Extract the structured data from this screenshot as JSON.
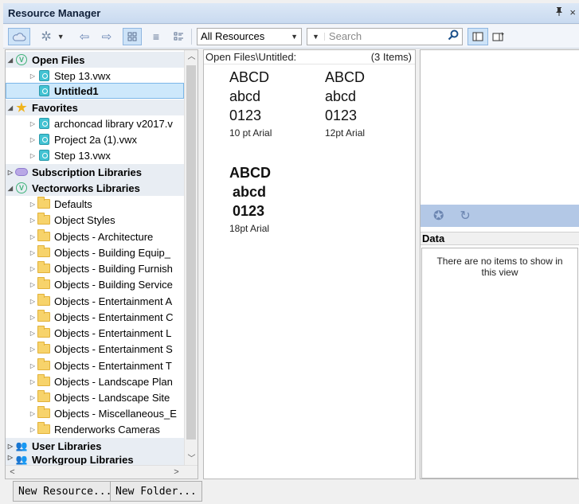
{
  "window": {
    "title": "Resource Manager",
    "pin_icon": "pin-icon",
    "close_glyph": "×"
  },
  "toolbar": {
    "filter_value": "All Resources",
    "search_placeholder": "Search"
  },
  "tree": {
    "open_files": {
      "label": "Open Files",
      "items": [
        "Step 13.vwx",
        "Untitled1"
      ]
    },
    "favorites": {
      "label": "Favorites",
      "items": [
        "archoncad library v2017.v",
        "Project 2a (1).vwx",
        "Step 13.vwx"
      ]
    },
    "subscription": {
      "label": "Subscription Libraries"
    },
    "vectorworks": {
      "label": "Vectorworks Libraries",
      "items": [
        "Defaults",
        "Object Styles",
        "Objects - Architecture",
        "Objects - Building Equip_",
        "Objects - Building Furnish",
        "Objects - Building Service",
        "Objects - Entertainment A",
        "Objects - Entertainment C",
        "Objects - Entertainment L",
        "Objects - Entertainment S",
        "Objects - Entertainment T",
        "Objects - Landscape Plan",
        "Objects - Landscape Site",
        "Objects - Miscellaneous_E",
        "Renderworks Cameras"
      ]
    },
    "user_libraries": {
      "label": "User Libraries"
    },
    "workgroup_libraries": {
      "label": "Workgroup Libraries"
    }
  },
  "browser": {
    "path": "Open Files\\Untitled:",
    "count": "(3 Items)",
    "resources": [
      {
        "preview": [
          "ABCD",
          "abcd",
          "0123"
        ],
        "name": "10 pt Arial"
      },
      {
        "preview": [
          "ABCD",
          "abcd",
          "0123"
        ],
        "name": "12pt Arial"
      },
      {
        "preview": [
          "ABCD",
          "abcd",
          "0123"
        ],
        "name": "18pt Arial"
      }
    ]
  },
  "data_panel": {
    "header": "Data",
    "empty_message": "There are no items to show in this view"
  },
  "buttons": {
    "new_resource": "New Resource...",
    "new_folder": "New Folder..."
  }
}
